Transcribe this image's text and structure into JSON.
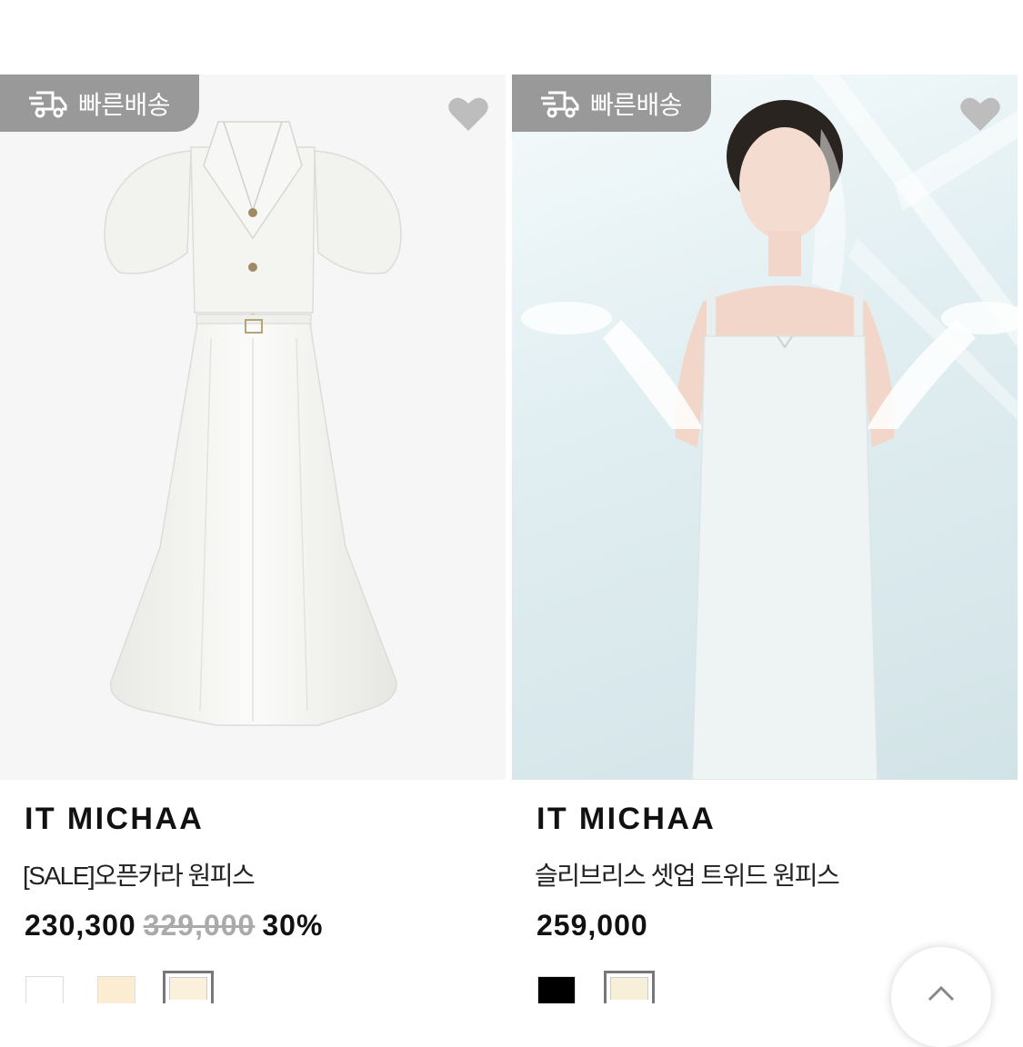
{
  "products": [
    {
      "badge": "빠른배송",
      "brand": "IT MICHAA",
      "name": "[SALE]오픈카라 원피스",
      "price": "230,300",
      "original_price": "329,000",
      "discount": "30%",
      "swatches": [
        "#ffffff",
        "#fbecd2",
        "#faf0dc"
      ],
      "selected_swatch": 2
    },
    {
      "badge": "빠른배송",
      "brand": "IT MICHAA",
      "name": "슬리브리스 셋업 트위드 원피스",
      "price": "259,000",
      "swatches": [
        "#000000",
        "#f8efd8"
      ],
      "selected_swatch": 1
    }
  ],
  "colors": {
    "badge_bg": "#999999",
    "heart": "#bdbdbd"
  },
  "icons": [
    "truck-icon",
    "heart-icon",
    "chevron-up-icon"
  ]
}
